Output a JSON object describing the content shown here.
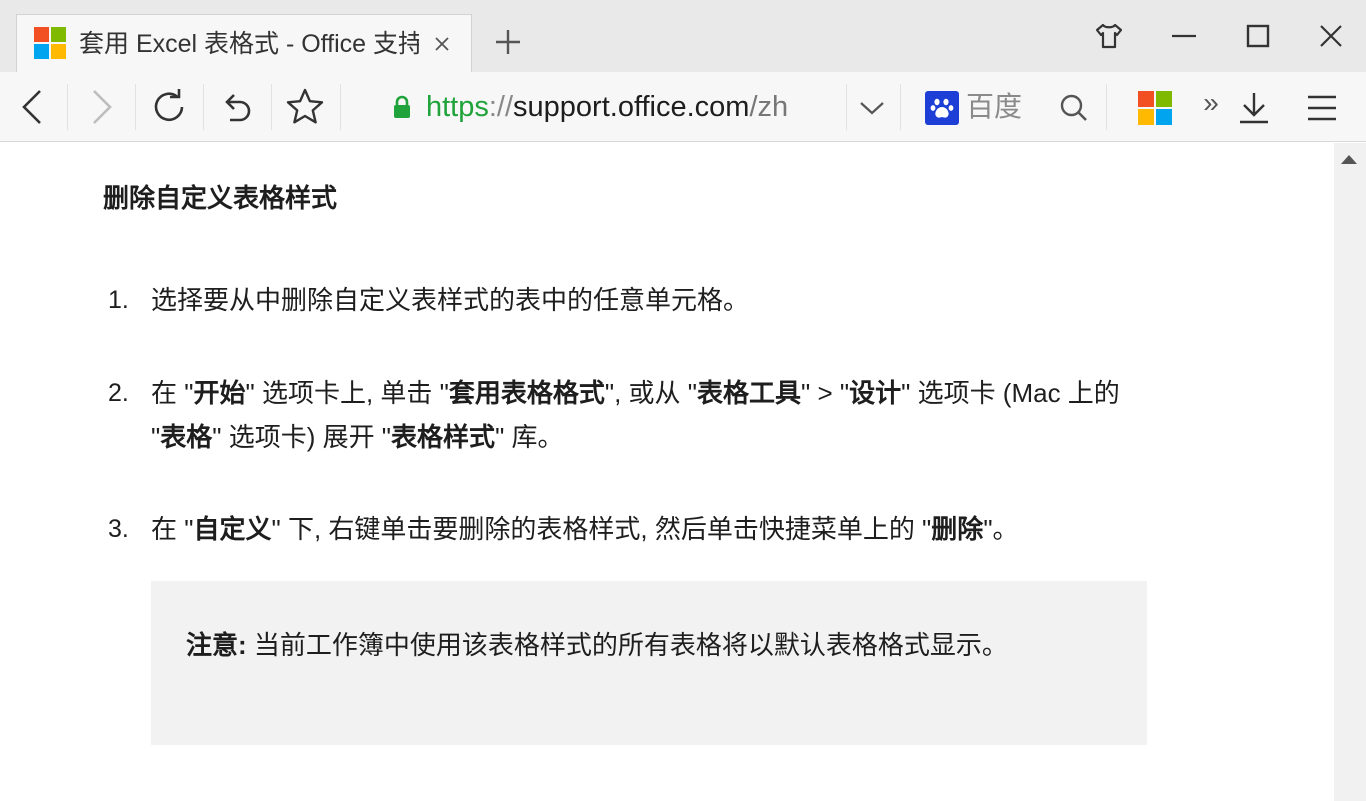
{
  "browser": {
    "tab": {
      "title": "套用 Excel 表格式 - Office 支持",
      "favicon": "microsoft-logo-icon",
      "close_icon": "close-icon"
    },
    "new_tab_icon": "plus-icon",
    "window_buttons": [
      "skin-icon",
      "minimize-icon",
      "maximize-icon",
      "close-icon"
    ],
    "nav_icons": [
      "back-icon",
      "forward-icon",
      "reload-icon",
      "undo-icon",
      "star-icon"
    ],
    "url": {
      "scheme": "https",
      "separator": "://",
      "host": "support.office.com",
      "path": "/zh"
    },
    "search_engine": {
      "name": "百度",
      "icon": "baidu-paw-icon"
    },
    "more_label": "»",
    "colors": {
      "secure_green": "#1fa33a",
      "baidu_blue": "#1d3fd6",
      "ms_red": "#f25022",
      "ms_green": "#7fba00",
      "ms_blue": "#00a4ef",
      "ms_yellow": "#ffb900"
    }
  },
  "article": {
    "section_title": "删除自定义表格样式",
    "steps": [
      {
        "num": "1.",
        "parts": [
          {
            "t": "选择要从中删除自定义表样式的表中的任意单元格。",
            "b": false
          }
        ]
      },
      {
        "num": "2.",
        "parts": [
          {
            "t": "在 \"",
            "b": false
          },
          {
            "t": "开始",
            "b": true
          },
          {
            "t": "\" 选项卡上, 单击 \"",
            "b": false
          },
          {
            "t": "套用表格格式",
            "b": true
          },
          {
            "t": "\", 或从 \"",
            "b": false
          },
          {
            "t": "表格工具",
            "b": true
          },
          {
            "t": "\" > \"",
            "b": false
          },
          {
            "t": "设计",
            "b": true
          },
          {
            "t": "\" 选项卡 (Mac 上的 \"",
            "b": false
          },
          {
            "t": "表格",
            "b": true
          },
          {
            "t": "\" 选项卡) 展开 \"",
            "b": false
          },
          {
            "t": "表格样式",
            "b": true
          },
          {
            "t": "\" 库。",
            "b": false
          }
        ]
      },
      {
        "num": "3.",
        "parts": [
          {
            "t": "在 \"",
            "b": false
          },
          {
            "t": "自定义",
            "b": true
          },
          {
            "t": "\" 下, 右键单击要删除的表格样式, 然后单击快捷菜单上的 \"",
            "b": false
          },
          {
            "t": "删除",
            "b": true
          },
          {
            "t": "\"。",
            "b": false
          }
        ]
      }
    ],
    "note": {
      "label": "注意:",
      "text": " 当前工作簿中使用该表格样式的所有表格将以默认表格格式显示。"
    }
  }
}
